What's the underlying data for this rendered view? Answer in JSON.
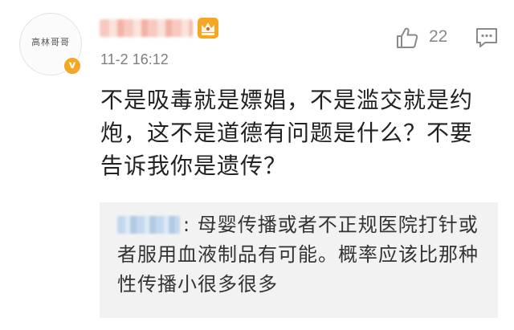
{
  "comment": {
    "avatar_label": "高林哥哥",
    "verified_mark": "v",
    "timestamp": "11-2 16:12",
    "like_count": "22",
    "body": "不是吸毒就是嫖娼，不是滥交就是约炮，这不是道德有问题是什么？不要告诉我你是遗传？"
  },
  "reply": {
    "text": ": 母婴传播或者不正规医院打针或者服用血液制品有可能。概率应该比那种性传播小很多很多"
  },
  "colors": {
    "crown": "#f5a623",
    "verified": "#f5a623",
    "icon_gray": "#8a8a8a",
    "reply_bg": "#f2f2f2"
  },
  "icons": [
    "crown-icon",
    "verified-badge",
    "thumbs-up-icon",
    "comment-icon"
  ]
}
